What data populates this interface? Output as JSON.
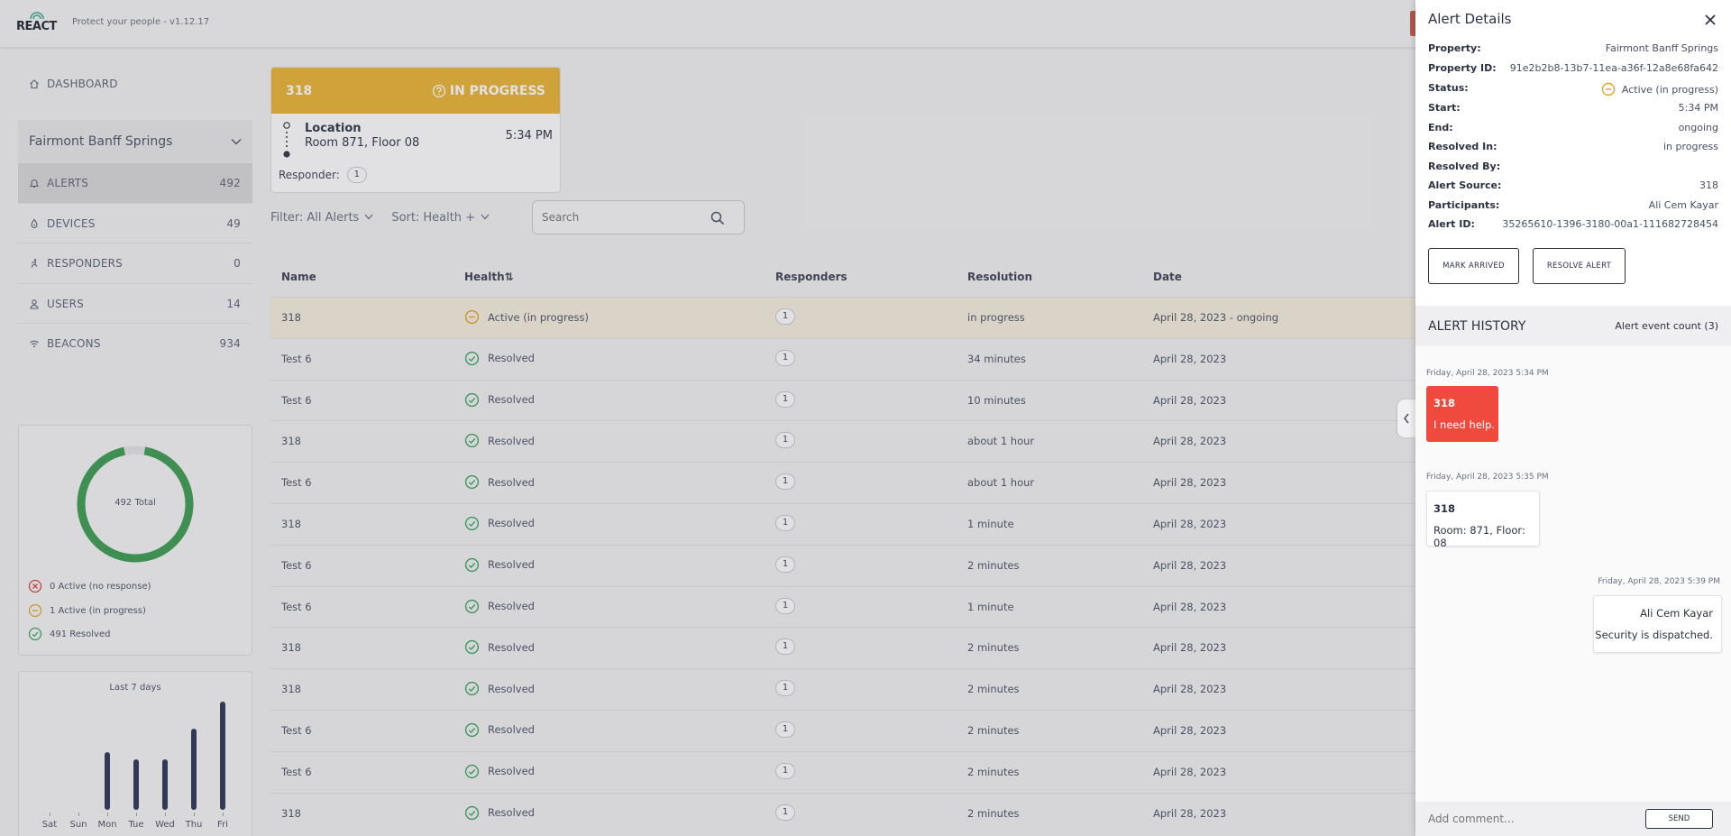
{
  "header": {
    "logo_text": "REACT",
    "tagline": "Protect your people - v1.12.17"
  },
  "sidebar": {
    "dashboard_label": "DASHBOARD",
    "property_name": "Fairmont Banff Springs",
    "items": [
      {
        "label": "ALERTS",
        "count": "492",
        "icon": "bell-icon"
      },
      {
        "label": "DEVICES",
        "count": "49",
        "icon": "droplet-icon"
      },
      {
        "label": "RESPONDERS",
        "count": "0",
        "icon": "runner-icon"
      },
      {
        "label": "USERS",
        "count": "14",
        "icon": "user-icon"
      },
      {
        "label": "BEACONS",
        "count": "934",
        "icon": "wifi-icon"
      }
    ]
  },
  "summary": {
    "total_label": "492 Total",
    "resolved_fraction": 0.998,
    "legend": [
      {
        "label": "0 Active (no response)",
        "icon": "x-circle-icon",
        "color": "#d6453d"
      },
      {
        "label": "1 Active (in progress)",
        "icon": "minus-circle-icon",
        "color": "#e3a22a"
      },
      {
        "label": "491 Resolved",
        "icon": "check-circle-icon",
        "color": "#3aa55d"
      }
    ],
    "donut_color": "#3a9a4f"
  },
  "chart_data": {
    "type": "bar",
    "title": "Last 7 days",
    "categories": [
      "Sat",
      "Sun",
      "Mon",
      "Tue",
      "Wed",
      "Thu",
      "Fri"
    ],
    "values": [
      0,
      0,
      55,
      48,
      48,
      77,
      103
    ],
    "color": "#2a3452"
  },
  "active_alert": {
    "source": "318",
    "status": "IN PROGRESS",
    "location_label": "Location",
    "location_value": "Room 871, Floor 08",
    "time": "5:34 PM",
    "responder_label": "Responder:",
    "responder_count": "1"
  },
  "filters": {
    "filter_label": "Filter:",
    "filter_value": "All Alerts",
    "sort_label": "Sort:",
    "sort_value": "Health +",
    "search_placeholder": "Search"
  },
  "table": {
    "headers": {
      "name": "Name",
      "health": "Health⇅",
      "responders": "Responders",
      "resolution": "Resolution",
      "date": "Date"
    },
    "rows": [
      {
        "name": "318",
        "health": "Active (in progress)",
        "status": "progress",
        "responders": "1",
        "resolution": "in progress",
        "date": "April 28, 2023 - ongoing"
      },
      {
        "name": "Test 6",
        "health": "Resolved",
        "status": "resolved",
        "responders": "1",
        "resolution": "34 minutes",
        "date": "April 28, 2023"
      },
      {
        "name": "Test 6",
        "health": "Resolved",
        "status": "resolved",
        "responders": "1",
        "resolution": "10 minutes",
        "date": "April 28, 2023"
      },
      {
        "name": "318",
        "health": "Resolved",
        "status": "resolved",
        "responders": "1",
        "resolution": "about 1 hour",
        "date": "April 28, 2023"
      },
      {
        "name": "Test 6",
        "health": "Resolved",
        "status": "resolved",
        "responders": "1",
        "resolution": "about 1 hour",
        "date": "April 28, 2023"
      },
      {
        "name": "318",
        "health": "Resolved",
        "status": "resolved",
        "responders": "1",
        "resolution": "1 minute",
        "date": "April 28, 2023"
      },
      {
        "name": "Test 6",
        "health": "Resolved",
        "status": "resolved",
        "responders": "1",
        "resolution": "2 minutes",
        "date": "April 28, 2023"
      },
      {
        "name": "Test 6",
        "health": "Resolved",
        "status": "resolved",
        "responders": "1",
        "resolution": "1 minute",
        "date": "April 28, 2023"
      },
      {
        "name": "318",
        "health": "Resolved",
        "status": "resolved",
        "responders": "1",
        "resolution": "2 minutes",
        "date": "April 28, 2023"
      },
      {
        "name": "318",
        "health": "Resolved",
        "status": "resolved",
        "responders": "1",
        "resolution": "2 minutes",
        "date": "April 28, 2023"
      },
      {
        "name": "Test 6",
        "health": "Resolved",
        "status": "resolved",
        "responders": "1",
        "resolution": "2 minutes",
        "date": "April 28, 2023"
      },
      {
        "name": "Test 6",
        "health": "Resolved",
        "status": "resolved",
        "responders": "1",
        "resolution": "2 minutes",
        "date": "April 28, 2023"
      },
      {
        "name": "318",
        "health": "Resolved",
        "status": "resolved",
        "responders": "1",
        "resolution": "2 minutes",
        "date": "April 28, 2023"
      }
    ]
  },
  "drawer": {
    "title": "Alert Details",
    "details": [
      {
        "key": "Property:",
        "value": "Fairmont Banff Springs"
      },
      {
        "key": "Property ID:",
        "value": "91e2b2b8-13b7-11ea-a36f-12a8e68fa642"
      },
      {
        "key": "Status:",
        "value": "Active (in progress)"
      },
      {
        "key": "Start:",
        "value": "5:34 PM"
      },
      {
        "key": "End:",
        "value": "ongoing"
      },
      {
        "key": "Resolved In:",
        "value": "in progress"
      },
      {
        "key": "Resolved By:",
        "value": ""
      },
      {
        "key": "Alert Source:",
        "value": "318"
      },
      {
        "key": "Participants:",
        "value": "Ali Cem Kayar"
      },
      {
        "key": "Alert ID:",
        "value": "35265610-1396-3180-00a1-111682728454"
      }
    ],
    "mark_arrived_label": "MARK ARRIVED",
    "resolve_label": "RESOLVE ALERT",
    "history_title": "ALERT HISTORY",
    "history_count": "Alert event count (3)",
    "events": [
      {
        "timestamp": "Friday, April 28, 2023 5:34 PM",
        "who": "318",
        "body": "I need help."
      },
      {
        "timestamp": "Friday, April 28, 2023 5:35 PM",
        "who": "318",
        "body": "Room: 871, Floor: 08"
      },
      {
        "timestamp": "Friday, April 28, 2023 5:39 PM",
        "who": "Ali Cem Kayar",
        "body": "Security is dispatched."
      }
    ],
    "comment_placeholder": "Add comment...",
    "send_label": "SEND"
  }
}
